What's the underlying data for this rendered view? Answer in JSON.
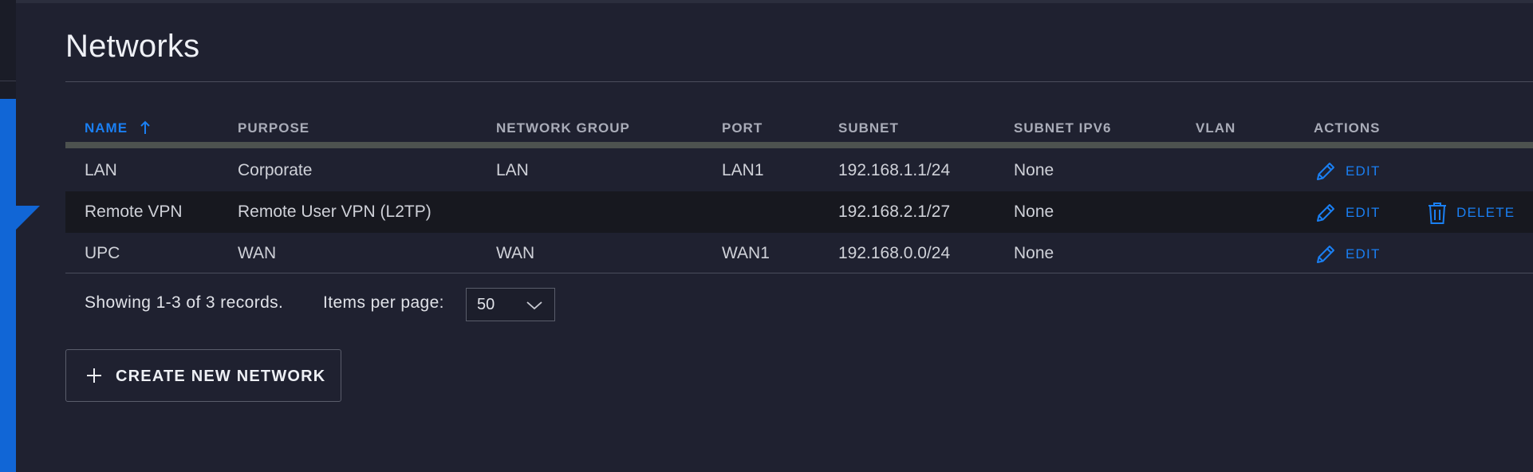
{
  "page": {
    "title": "Networks"
  },
  "table": {
    "columns": [
      {
        "key": "name",
        "label": "NAME",
        "sorted": "ascending"
      },
      {
        "key": "purpose",
        "label": "PURPOSE"
      },
      {
        "key": "network_group",
        "label": "NETWORK GROUP"
      },
      {
        "key": "port",
        "label": "PORT"
      },
      {
        "key": "subnet",
        "label": "SUBNET"
      },
      {
        "key": "subnet_ipv6",
        "label": "SUBNET IPV6"
      },
      {
        "key": "vlan",
        "label": "VLAN"
      },
      {
        "key": "actions",
        "label": "ACTIONS"
      }
    ],
    "rows": [
      {
        "name": "LAN",
        "purpose": "Corporate",
        "network_group": "LAN",
        "port": "LAN1",
        "subnet": "192.168.1.1/24",
        "subnet_ipv6": "None",
        "vlan": "",
        "actions": [
          "EDIT"
        ]
      },
      {
        "name": "Remote VPN",
        "purpose": "Remote User VPN (L2TP)",
        "network_group": "",
        "port": "",
        "subnet": "192.168.2.1/27",
        "subnet_ipv6": "None",
        "vlan": "",
        "actions": [
          "EDIT",
          "DELETE"
        ]
      },
      {
        "name": "UPC",
        "purpose": "WAN",
        "network_group": "WAN",
        "port": "WAN1",
        "subnet": "192.168.0.0/24",
        "subnet_ipv6": "None",
        "vlan": "",
        "actions": [
          "EDIT"
        ]
      }
    ]
  },
  "footer": {
    "showing_text": "Showing 1-3 of 3 records.",
    "items_per_page_label": "Items per page:",
    "items_per_page_value": "50"
  },
  "create_button": {
    "label": "CREATE NEW NETWORK",
    "icon": "plus-icon"
  },
  "icons": {
    "edit": "pencil-icon",
    "delete": "trash-icon",
    "sort": "arrow-up-icon",
    "select": "chevron-down-icon"
  },
  "colors": {
    "background": "#1f2130",
    "accent": "#1a7ff2",
    "sidebar_active": "#1166d6"
  }
}
